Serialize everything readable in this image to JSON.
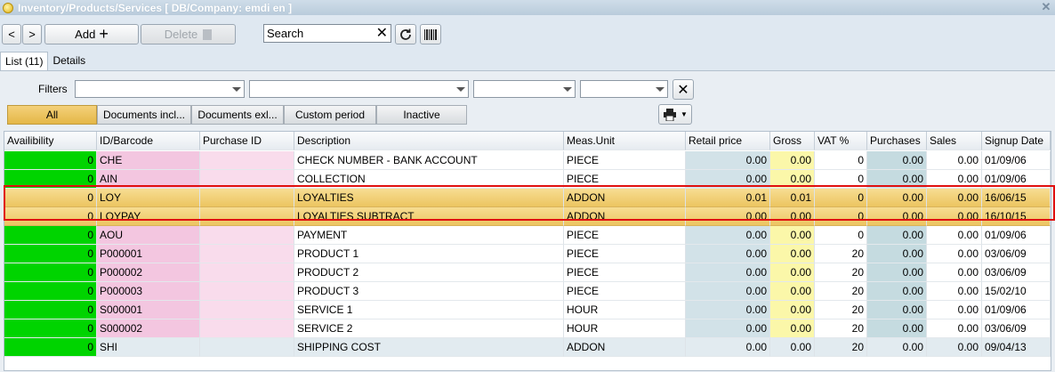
{
  "window": {
    "title": "Inventory/Products/Services  [ DB/Company: emdi en ]"
  },
  "toolbar": {
    "back_label": "<",
    "forward_label": ">",
    "add_label": "Add",
    "add_icon": "+",
    "delete_label": "Delete",
    "search_placeholder": "Search",
    "clear_glyph": "✕"
  },
  "tabs": [
    {
      "label": "List (11)",
      "active": true
    },
    {
      "label": "Details",
      "active": false
    }
  ],
  "filters": {
    "label": "Filters",
    "categories": [
      "All",
      "Documents incl...",
      "Documents exl...",
      "Custom period",
      "Inactive"
    ],
    "active_category": "All"
  },
  "table": {
    "columns": [
      "Availibility",
      "ID/Barcode",
      "Purchase ID",
      "Description",
      "Meas.Unit",
      "Retail price",
      "Gross",
      "VAT %",
      "Purchases",
      "Sales",
      "Signup Date"
    ],
    "rows": [
      {
        "availability": "0",
        "id": "CHE",
        "purchase_id": "",
        "description": "CHECK NUMBER - BANK ACCOUNT",
        "unit": "PIECE",
        "retail": "0.00",
        "gross": "0.00",
        "vat": "0",
        "purchases": "0.00",
        "sales": "0.00",
        "date": "01/09/06",
        "selected": false
      },
      {
        "availability": "0",
        "id": "AIN",
        "purchase_id": "",
        "description": "COLLECTION",
        "unit": "PIECE",
        "retail": "0.00",
        "gross": "0.00",
        "vat": "0",
        "purchases": "0.00",
        "sales": "0.00",
        "date": "01/09/06",
        "selected": false
      },
      {
        "availability": "0",
        "id": "LOY",
        "purchase_id": "",
        "description": "LOYALTIES",
        "unit": "ADDON",
        "retail": "0.01",
        "gross": "0.01",
        "vat": "0",
        "purchases": "0.00",
        "sales": "0.00",
        "date": "16/06/15",
        "selected": true
      },
      {
        "availability": "0",
        "id": "LOYPAY",
        "purchase_id": "",
        "description": "LOYALTIES SUBTRACT",
        "unit": "ADDON",
        "retail": "0.00",
        "gross": "0.00",
        "vat": "0",
        "purchases": "0.00",
        "sales": "0.00",
        "date": "16/10/15",
        "selected": true
      },
      {
        "availability": "0",
        "id": "AOU",
        "purchase_id": "",
        "description": "PAYMENT",
        "unit": "PIECE",
        "retail": "0.00",
        "gross": "0.00",
        "vat": "0",
        "purchases": "0.00",
        "sales": "0.00",
        "date": "01/09/06",
        "selected": false
      },
      {
        "availability": "0",
        "id": "P000001",
        "purchase_id": "",
        "description": "PRODUCT 1",
        "unit": "PIECE",
        "retail": "0.00",
        "gross": "0.00",
        "vat": "20",
        "purchases": "0.00",
        "sales": "0.00",
        "date": "03/06/09",
        "selected": false
      },
      {
        "availability": "0",
        "id": "P000002",
        "purchase_id": "",
        "description": "PRODUCT 2",
        "unit": "PIECE",
        "retail": "0.00",
        "gross": "0.00",
        "vat": "20",
        "purchases": "0.00",
        "sales": "0.00",
        "date": "03/06/09",
        "selected": false
      },
      {
        "availability": "0",
        "id": "P000003",
        "purchase_id": "",
        "description": "PRODUCT 3",
        "unit": "PIECE",
        "retail": "0.00",
        "gross": "0.00",
        "vat": "20",
        "purchases": "0.00",
        "sales": "0.00",
        "date": "15/02/10",
        "selected": false
      },
      {
        "availability": "0",
        "id": "S000001",
        "purchase_id": "",
        "description": "SERVICE 1",
        "unit": "HOUR",
        "retail": "0.00",
        "gross": "0.00",
        "vat": "20",
        "purchases": "0.00",
        "sales": "0.00",
        "date": "01/09/06",
        "selected": false
      },
      {
        "availability": "0",
        "id": "S000002",
        "purchase_id": "",
        "description": "SERVICE 2",
        "unit": "HOUR",
        "retail": "0.00",
        "gross": "0.00",
        "vat": "20",
        "purchases": "0.00",
        "sales": "0.00",
        "date": "03/06/09",
        "selected": false
      },
      {
        "availability": "0",
        "id": "SHI",
        "purchase_id": "",
        "description": "SHIPPING COST",
        "unit": "ADDON",
        "retail": "0.00",
        "gross": "0.00",
        "vat": "20",
        "purchases": "0.00",
        "sales": "0.00",
        "date": "09/04/13",
        "selected": false
      }
    ]
  },
  "colors": {
    "availability": "#00d400",
    "id_cell": "#f3c6e0",
    "selection": "#ecc561",
    "highlight_border": "#e01010"
  }
}
